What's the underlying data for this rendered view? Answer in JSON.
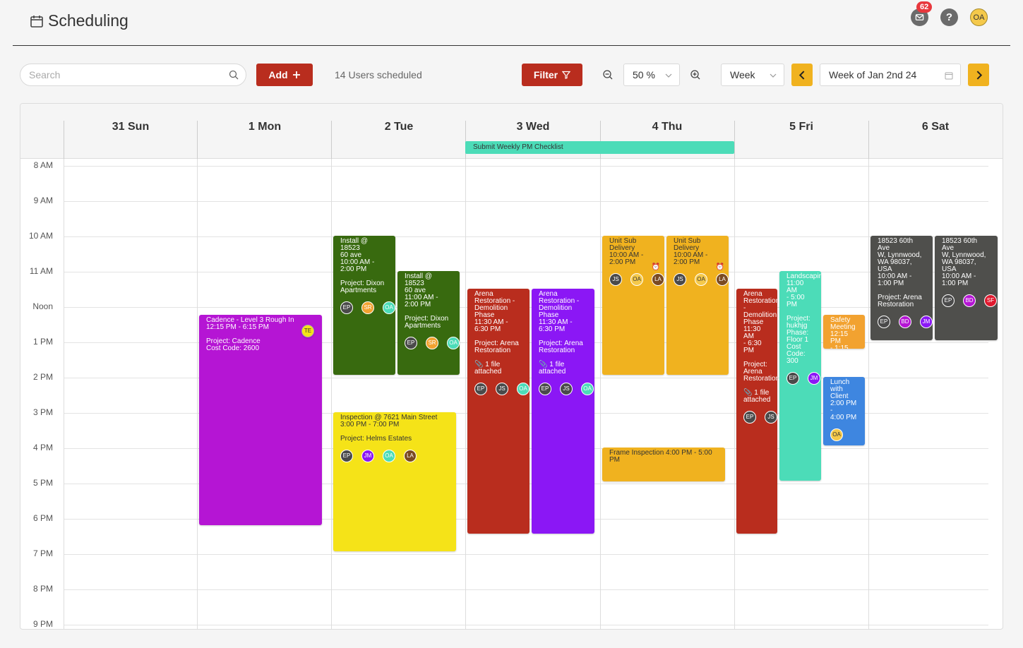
{
  "header": {
    "title": "Scheduling",
    "mail_count": "62",
    "help_icon": "?",
    "user_initials": "OA"
  },
  "toolbar": {
    "search_placeholder": "Search",
    "add_label": "Add",
    "users_scheduled": "14 Users scheduled",
    "filter_label": "Filter",
    "zoom_value": "50 %",
    "view_value": "Week",
    "week_value": "Week of Jan 2nd 24"
  },
  "colors": {
    "red": "#b92d1e",
    "amber": "#f0b21f",
    "purple": "#b515d4",
    "green": "#386a0f",
    "yellow": "#f5e318",
    "violet": "#8b17f5",
    "teal": "#4cdcb8",
    "gray": "#4f4f4c",
    "blue": "#3e86e0",
    "orange": "#f2a230"
  },
  "calendar": {
    "days": [
      "31 Sun",
      "1 Mon",
      "2 Tue",
      "3 Wed",
      "4 Thu",
      "5 Fri",
      "6 Sat"
    ],
    "hours": [
      "8 AM",
      "9 AM",
      "10 AM",
      "11 AM",
      "Noon",
      "1 PM",
      "2 PM",
      "3 PM",
      "4 PM",
      "5 PM",
      "6 PM",
      "7 PM",
      "8 PM",
      "9 PM"
    ],
    "allday_event": "Submit Weekly PM Checklist",
    "events": [
      {
        "lines": [
          "Cadence - Level 3 Rough In",
          "12:15 PM - 6:15 PM",
          "",
          "Project: Cadence",
          "Cost Code: 2600"
        ],
        "avatars": []
      },
      {
        "lines": [
          "TE"
        ],
        "avatars": []
      },
      {
        "lines": [
          "Install @ 18523",
          "60 ave",
          "10:00 AM -",
          "2:00 PM",
          "",
          "Project: Dixon",
          "Apartments"
        ],
        "avatars": [
          "EP",
          "SR",
          "OA"
        ]
      },
      {
        "lines": [
          "Install @ 18523",
          "60 ave",
          "11:00 AM -",
          "2:00 PM",
          "",
          "Project: Dixon",
          "Apartments"
        ],
        "avatars": [
          "EP",
          "SR",
          "OA"
        ]
      },
      {
        "lines": [
          "Inspection @ 7621 Main Street",
          "3:00 PM - 7:00 PM",
          "",
          "Project: Helms Estates"
        ],
        "avatars": [
          "EP",
          "JM",
          "OA",
          "LA"
        ]
      },
      {
        "lines": [
          "Arena",
          "Restoration -",
          "Demolition",
          "Phase",
          "11:30 AM -",
          "6:30 PM",
          "",
          "Project: Arena",
          "Restoration",
          "",
          "📎 1 file",
          "attached"
        ],
        "avatars": [
          "EP",
          "JS",
          "OA"
        ]
      },
      {
        "lines": [
          "Arena",
          "Restoration -",
          "Demolition",
          "Phase",
          "11:30 AM -",
          "6:30 PM",
          "",
          "Project: Arena",
          "Restoration",
          "",
          "📎 1 file",
          "attached"
        ],
        "avatars": [
          "EP",
          "JS",
          "OA"
        ]
      },
      {
        "lines": [
          "Unit Sub",
          "Delivery",
          "10:00 AM -",
          "2:00 PM"
        ],
        "avatars": [
          "JS",
          "OA",
          "LA"
        ]
      },
      {
        "lines": [
          "Unit Sub",
          "Delivery",
          "10:00 AM -",
          "2:00 PM"
        ],
        "avatars": [
          "JS",
          "OA",
          "LA"
        ]
      },
      {
        "lines": [
          "Frame Inspection 4:00 PM - 5:00",
          "PM"
        ],
        "avatars": []
      },
      {
        "lines": [
          "Arena",
          "Restoration",
          "-",
          "Demolition",
          "Phase",
          "11:30 AM",
          "- 6:30 PM",
          "",
          "Project:",
          "Arena",
          "Restoration",
          "",
          "📎 1 file",
          "attached"
        ],
        "avatars": [
          "EP",
          "JS"
        ]
      },
      {
        "lines": [
          "Landscaping",
          "11:00 AM",
          "- 5:00 PM",
          "",
          "Project:",
          "hukhjg",
          "Phase:",
          "Floor 1",
          "Cost",
          "Code:",
          "300"
        ],
        "avatars": [
          "EP",
          "JM"
        ]
      },
      {
        "lines": [
          "Safety",
          "Meeting",
          "12:15 PM",
          "- 1:15 PM"
        ],
        "avatars": []
      },
      {
        "lines": [
          "Lunch",
          "with",
          "Client",
          "2:00 PM -",
          "4:00 PM"
        ],
        "avatars": [
          "OA"
        ]
      },
      {
        "lines": [
          "18523 60th Ave",
          "W, Lynnwood,",
          "WA 98037, USA",
          "10:00 AM -",
          "1:00 PM",
          "",
          "Project: Arena",
          "Restoration"
        ],
        "avatars": [
          "EP",
          "BD",
          "JM"
        ]
      },
      {
        "lines": [
          "18523 60th Ave",
          "W, Lynnwood,",
          "WA 98037, USA",
          "10:00 AM -",
          "1:00 PM"
        ],
        "avatars": [
          "EP",
          "BD",
          "SF"
        ]
      }
    ]
  }
}
